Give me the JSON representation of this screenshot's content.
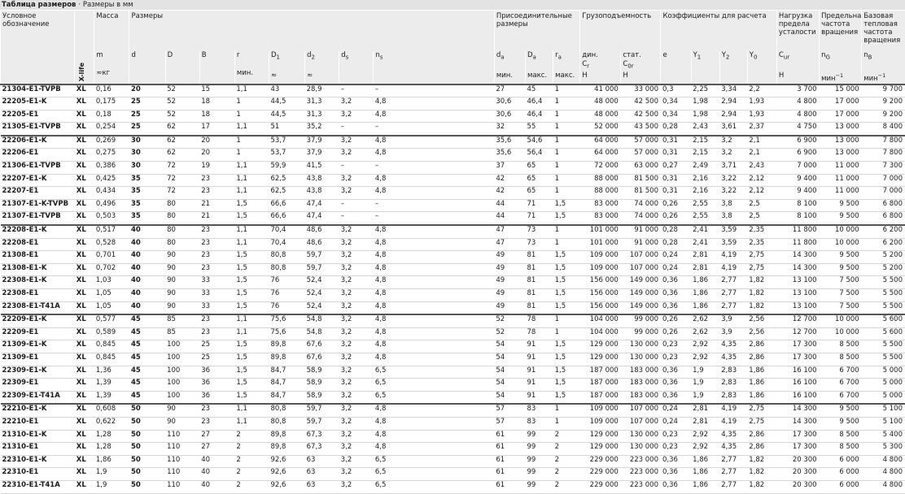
{
  "title": "Таблица размеров",
  "subtitle": "· Размеры в мм",
  "headers": {
    "designation": "Условное обозначение",
    "xlife": "X-life",
    "mass": "Масса",
    "dims": "Размеры",
    "mount": "Присоединительные размеры",
    "load": "Грузоподъемность",
    "coef": "Коэффициенты для расчета",
    "fatigue": "Нагрузка предела усталости",
    "limspeed": "Предельная частота вращения",
    "refspeed": "Базовая тепловая частота вращения"
  },
  "sub": {
    "m": "m",
    "m_unit": "≈кг",
    "d": "d",
    "D": "D",
    "B": "B",
    "r": "r",
    "r_unit": "мин.",
    "D1": "D",
    "D1_sub": "1",
    "D1_unit": "≈",
    "d2": "d",
    "d2_sub": "2",
    "d2_unit": "≈",
    "ds": "d",
    "ds_sub": "s",
    "ns": "n",
    "ns_sub": "s",
    "da": "d",
    "da_sub": "a",
    "da_unit": "мин.",
    "Da": "D",
    "Da_sub": "a",
    "Da_unit": "макс.",
    "ra": "r",
    "ra_sub": "a",
    "ra_unit": "макс.",
    "Cr_label": "дин.",
    "Cr": "C",
    "Cr_sub": "r",
    "Cr_unit": "Н",
    "C0r_label": "стат.",
    "C0r": "C",
    "C0r_sub": "0r",
    "C0r_unit": "Н",
    "e": "e",
    "Y1": "Y",
    "Y1_sub": "1",
    "Y2": "Y",
    "Y2_sub": "2",
    "Y0": "Y",
    "Y0_sub": "0",
    "Cur": "C",
    "Cur_sub": "ur",
    "Cur_unit": "Н",
    "nG": "n",
    "nG_sub": "G",
    "nG_unit": "мин",
    "nG_sup": "−1",
    "nB": "n",
    "nB_sub": "B",
    "nB_unit": "мин",
    "nB_sup": "−1"
  },
  "rows": [
    [
      "21304-E1-TVPB",
      "XL",
      "0,16",
      "20",
      "52",
      "15",
      "1,1",
      "43",
      "28,9",
      "–",
      "–",
      "27",
      "45",
      "1",
      "41 000",
      "33 000",
      "0,3",
      "2,25",
      "3,34",
      "2,2",
      "3 700",
      "15 000",
      "9 700"
    ],
    [
      "22205-E1-K",
      "XL",
      "0,175",
      "25",
      "52",
      "18",
      "1",
      "44,5",
      "31,3",
      "3,2",
      "4,8",
      "30,6",
      "46,4",
      "1",
      "48 000",
      "42 500",
      "0,34",
      "1,98",
      "2,94",
      "1,93",
      "4 800",
      "17 000",
      "9 200"
    ],
    [
      "22205-E1",
      "XL",
      "0,18",
      "25",
      "52",
      "18",
      "1",
      "44,5",
      "31,3",
      "3,2",
      "4,8",
      "30,6",
      "46,4",
      "1",
      "48 000",
      "42 500",
      "0,34",
      "1,98",
      "2,94",
      "1,93",
      "4 800",
      "17 000",
      "9 200"
    ],
    [
      "21305-E1-TVPB",
      "XL",
      "0,254",
      "25",
      "62",
      "17",
      "1,1",
      "51",
      "35,2",
      "–",
      "–",
      "32",
      "55",
      "1",
      "52 000",
      "43 500",
      "0,28",
      "2,43",
      "3,61",
      "2,37",
      "4 750",
      "13 000",
      "8 400"
    ],
    [
      "22206-E1-K",
      "XL",
      "0,269",
      "30",
      "62",
      "20",
      "1",
      "53,7",
      "37,9",
      "3,2",
      "4,8",
      "35,6",
      "54,6",
      "1",
      "64 000",
      "57 000",
      "0,31",
      "2,15",
      "3,2",
      "2,1",
      "6 900",
      "13 000",
      "7 800"
    ],
    [
      "22206-E1",
      "XL",
      "0,275",
      "30",
      "62",
      "20",
      "1",
      "53,7",
      "37,9",
      "3,2",
      "4,8",
      "35,6",
      "56,4",
      "1",
      "64 000",
      "57 000",
      "0,31",
      "2,15",
      "3,2",
      "2,1",
      "6 900",
      "13 000",
      "7 800"
    ],
    [
      "21306-E1-TVPB",
      "XL",
      "0,386",
      "30",
      "72",
      "19",
      "1,1",
      "59,9",
      "41,5",
      "–",
      "–",
      "37",
      "65",
      "1",
      "72 000",
      "63 000",
      "0,27",
      "2,49",
      "3,71",
      "2,43",
      "7 000",
      "11 000",
      "7 300"
    ],
    [
      "22207-E1-K",
      "XL",
      "0,425",
      "35",
      "72",
      "23",
      "1,1",
      "62,5",
      "43,8",
      "3,2",
      "4,8",
      "42",
      "65",
      "1",
      "88 000",
      "81 500",
      "0,31",
      "2,16",
      "3,22",
      "2,12",
      "9 400",
      "11 000",
      "7 000"
    ],
    [
      "22207-E1",
      "XL",
      "0,434",
      "35",
      "72",
      "23",
      "1,1",
      "62,5",
      "43,8",
      "3,2",
      "4,8",
      "42",
      "65",
      "1",
      "88 000",
      "81 500",
      "0,31",
      "2,16",
      "3,22",
      "2,12",
      "9 400",
      "11 000",
      "7 000"
    ],
    [
      "21307-E1-K-TVPB",
      "XL",
      "0,496",
      "35",
      "80",
      "21",
      "1,5",
      "66,6",
      "47,4",
      "–",
      "–",
      "44",
      "71",
      "1,5",
      "83 000",
      "74 000",
      "0,26",
      "2,55",
      "3,8",
      "2,5",
      "8 100",
      "9 500",
      "6 800"
    ],
    [
      "21307-E1-TVPB",
      "XL",
      "0,503",
      "35",
      "80",
      "21",
      "1,5",
      "66,6",
      "47,4",
      "–",
      "–",
      "44",
      "71",
      "1,5",
      "83 000",
      "74 000",
      "0,26",
      "2,55",
      "3,8",
      "2,5",
      "8 100",
      "9 500",
      "6 800"
    ],
    [
      "22208-E1-K",
      "XL",
      "0,517",
      "40",
      "80",
      "23",
      "1,1",
      "70,4",
      "48,6",
      "3,2",
      "4,8",
      "47",
      "73",
      "1",
      "101 000",
      "91 000",
      "0,28",
      "2,41",
      "3,59",
      "2,35",
      "11 800",
      "10 000",
      "6 200"
    ],
    [
      "22208-E1",
      "XL",
      "0,528",
      "40",
      "80",
      "23",
      "1,1",
      "70,4",
      "48,6",
      "3,2",
      "4,8",
      "47",
      "73",
      "1",
      "101 000",
      "91 000",
      "0,28",
      "2,41",
      "3,59",
      "2,35",
      "11 800",
      "10 000",
      "6 200"
    ],
    [
      "21308-E1",
      "XL",
      "0,701",
      "40",
      "90",
      "23",
      "1,5",
      "80,8",
      "59,7",
      "3,2",
      "4,8",
      "49",
      "81",
      "1,5",
      "109 000",
      "107 000",
      "0,24",
      "2,81",
      "4,19",
      "2,75",
      "14 300",
      "9 500",
      "5 200"
    ],
    [
      "21308-E1-K",
      "XL",
      "0,702",
      "40",
      "90",
      "23",
      "1,5",
      "80,8",
      "59,7",
      "3,2",
      "4,8",
      "49",
      "81",
      "1,5",
      "109 000",
      "107 000",
      "0,24",
      "2,81",
      "4,19",
      "2,75",
      "14 300",
      "9 500",
      "5 200"
    ],
    [
      "22308-E1-K",
      "XL",
      "1,03",
      "40",
      "90",
      "33",
      "1,5",
      "76",
      "52,4",
      "3,2",
      "4,8",
      "49",
      "81",
      "1,5",
      "156 000",
      "149 000",
      "0,36",
      "1,86",
      "2,77",
      "1,82",
      "13 100",
      "7 500",
      "5 500"
    ],
    [
      "22308-E1",
      "XL",
      "1,05",
      "40",
      "90",
      "33",
      "1,5",
      "76",
      "52,4",
      "3,2",
      "4,8",
      "49",
      "81",
      "1,5",
      "156 000",
      "149 000",
      "0,36",
      "1,86",
      "2,77",
      "1,82",
      "13 100",
      "7 500",
      "5 500"
    ],
    [
      "22308-E1-T41A",
      "XL",
      "1,05",
      "40",
      "90",
      "33",
      "1,5",
      "76",
      "52,4",
      "3,2",
      "4,8",
      "49",
      "81",
      "1,5",
      "156 000",
      "149 000",
      "0,36",
      "1,86",
      "2,77",
      "1,82",
      "13 100",
      "7 500",
      "5 500"
    ],
    [
      "22209-E1-K",
      "XL",
      "0,577",
      "45",
      "85",
      "23",
      "1,1",
      "75,6",
      "54,8",
      "3,2",
      "4,8",
      "52",
      "78",
      "1",
      "104 000",
      "99 000",
      "0,26",
      "2,62",
      "3,9",
      "2,56",
      "12 700",
      "10 000",
      "5 600"
    ],
    [
      "22209-E1",
      "XL",
      "0,589",
      "45",
      "85",
      "23",
      "1,1",
      "75,6",
      "54,8",
      "3,2",
      "4,8",
      "52",
      "78",
      "1",
      "104 000",
      "99 000",
      "0,26",
      "2,62",
      "3,9",
      "2,56",
      "12 700",
      "10 000",
      "5 600"
    ],
    [
      "21309-E1-K",
      "XL",
      "0,845",
      "45",
      "100",
      "25",
      "1,5",
      "89,8",
      "67,6",
      "3,2",
      "4,8",
      "54",
      "91",
      "1,5",
      "129 000",
      "130 000",
      "0,23",
      "2,92",
      "4,35",
      "2,86",
      "17 300",
      "8 500",
      "5 500"
    ],
    [
      "21309-E1",
      "XL",
      "0,845",
      "45",
      "100",
      "25",
      "1,5",
      "89,8",
      "67,6",
      "3,2",
      "4,8",
      "54",
      "91",
      "1,5",
      "129 000",
      "130 000",
      "0,23",
      "2,92",
      "4,35",
      "2,86",
      "17 300",
      "8 500",
      "5 500"
    ],
    [
      "22309-E1-K",
      "XL",
      "1,36",
      "45",
      "100",
      "36",
      "1,5",
      "84,7",
      "58,9",
      "3,2",
      "6,5",
      "54",
      "91",
      "1,5",
      "187 000",
      "183 000",
      "0,36",
      "1,9",
      "2,83",
      "1,86",
      "16 100",
      "6 700",
      "5 000"
    ],
    [
      "22309-E1",
      "XL",
      "1,39",
      "45",
      "100",
      "36",
      "1,5",
      "84,7",
      "58,9",
      "3,2",
      "6,5",
      "54",
      "91",
      "1,5",
      "187 000",
      "183 000",
      "0,36",
      "1,9",
      "2,83",
      "1,86",
      "16 100",
      "6 700",
      "5 000"
    ],
    [
      "22309-E1-T41A",
      "XL",
      "1,39",
      "45",
      "100",
      "36",
      "1,5",
      "84,7",
      "58,9",
      "3,2",
      "6,5",
      "54",
      "91",
      "1,5",
      "187 000",
      "183 000",
      "0,36",
      "1,9",
      "2,83",
      "1,86",
      "16 100",
      "6 700",
      "5 000"
    ],
    [
      "22210-E1-K",
      "XL",
      "0,608",
      "50",
      "90",
      "23",
      "1,1",
      "80,8",
      "59,7",
      "3,2",
      "4,8",
      "57",
      "83",
      "1",
      "109 000",
      "107 000",
      "0,24",
      "2,81",
      "4,19",
      "2,75",
      "14 300",
      "9 500",
      "5 100"
    ],
    [
      "22210-E1",
      "XL",
      "0,622",
      "50",
      "90",
      "23",
      "1,1",
      "80,8",
      "59,7",
      "3,2",
      "4,8",
      "57",
      "83",
      "1",
      "109 000",
      "107 000",
      "0,24",
      "2,81",
      "4,19",
      "2,75",
      "14 300",
      "9 500",
      "5 100"
    ],
    [
      "21310-E1-K",
      "XL",
      "1,28",
      "50",
      "110",
      "27",
      "2",
      "89,8",
      "67,3",
      "3,2",
      "4,8",
      "61",
      "99",
      "2",
      "129 000",
      "130 000",
      "0,23",
      "2,92",
      "4,35",
      "2,86",
      "17 300",
      "8 500",
      "5 400"
    ],
    [
      "21310-E1",
      "XL",
      "1,28",
      "50",
      "110",
      "27",
      "2",
      "89,8",
      "67,3",
      "3,2",
      "4,8",
      "61",
      "99",
      "2",
      "129 000",
      "130 000",
      "0,23",
      "2,92",
      "4,35",
      "2,86",
      "17 300",
      "8 500",
      "5 300"
    ],
    [
      "22310-E1-K",
      "XL",
      "1,86",
      "50",
      "110",
      "40",
      "2",
      "92,6",
      "63",
      "3,2",
      "6,5",
      "61",
      "99",
      "2",
      "229 000",
      "223 000",
      "0,36",
      "1,86",
      "2,77",
      "1,82",
      "20 300",
      "6 000",
      "4 800"
    ],
    [
      "22310-E1",
      "XL",
      "1,9",
      "50",
      "110",
      "40",
      "2",
      "92,6",
      "63",
      "3,2",
      "6,5",
      "61",
      "99",
      "2",
      "229 000",
      "223 000",
      "0,36",
      "1,86",
      "2,77",
      "1,82",
      "20 300",
      "6 000",
      "4 800"
    ],
    [
      "22310-E1-T41A",
      "XL",
      "1,9",
      "50",
      "110",
      "40",
      "2",
      "92,6",
      "63",
      "3,2",
      "6,5",
      "61",
      "99",
      "2",
      "229 000",
      "223 000",
      "0,36",
      "1,86",
      "2,77",
      "1,82",
      "20 300",
      "6 000",
      "4 800"
    ]
  ],
  "group_ends": [
    3,
    10,
    17,
    24
  ]
}
